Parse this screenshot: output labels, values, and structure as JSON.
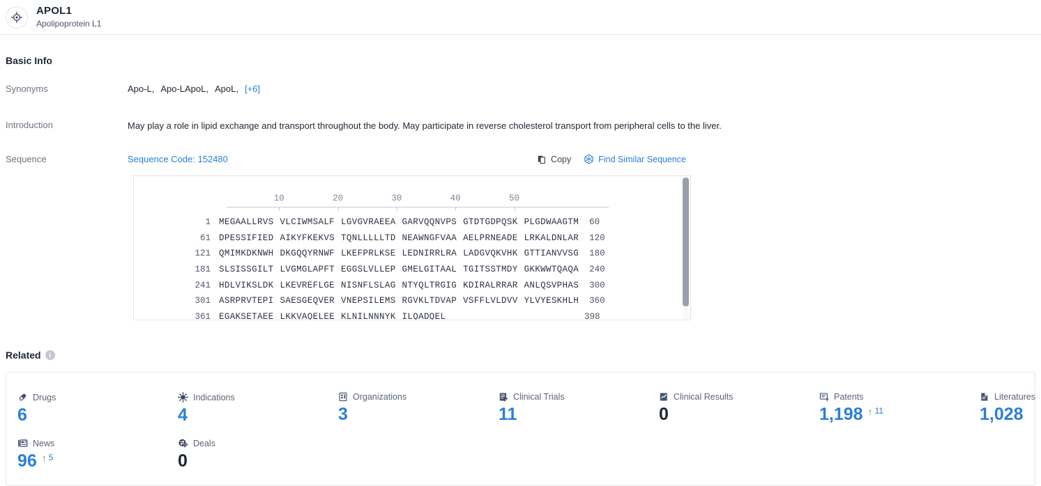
{
  "header": {
    "icon": "target-icon",
    "name": "APOL1",
    "subtitle": "Apolipoprotein L1"
  },
  "basic_info": {
    "title": "Basic Info",
    "synonyms": {
      "label": "Synonyms",
      "values": [
        "Apo-L,",
        "Apo-LApoL,",
        "ApoL,"
      ],
      "more": "[+6]"
    },
    "introduction": {
      "label": "Introduction",
      "text": "May play a role in lipid exchange and transport throughout the body. May participate in reverse cholesterol transport from peripheral cells to the liver."
    },
    "sequence": {
      "label": "Sequence",
      "code_label": "Sequence Code: 152480",
      "copy_label": "Copy",
      "similar_label": "Find Similar Sequence",
      "ruler": [
        10,
        20,
        30,
        40,
        50
      ],
      "lines": [
        {
          "start": "1",
          "blocks": [
            "MEGAALLRVS",
            "VLCIWMSALF",
            "LGVGVRAEEA",
            "GARVQQNVPS",
            "GTDTGDPQSK",
            "PLGDWAAGTM"
          ],
          "end": "60"
        },
        {
          "start": "61",
          "blocks": [
            "DPESSIFIED",
            "AIKYFKEKVS",
            "TQNLLLLLTD",
            "NEAWNGFVAA",
            "AELPRNEADE",
            "LRKALDNLAR"
          ],
          "end": "120"
        },
        {
          "start": "121",
          "blocks": [
            "QMIMKDKNWH",
            "DKGQQYRNWF",
            "LKEFPRLKSE",
            "LEDNIRRLRA",
            "LADGVQKVHK",
            "GTTIANVVSG"
          ],
          "end": "180"
        },
        {
          "start": "181",
          "blocks": [
            "SLSISSGILT",
            "LVGMGLAPFT",
            "EGGSLVLLEP",
            "GMELGITAAL",
            "TGITSSTMDY",
            "GKKWWTQAQA"
          ],
          "end": "240"
        },
        {
          "start": "241",
          "blocks": [
            "HDLVIKSLDK",
            "LKEVREFLGE",
            "NISNFLSLAG",
            "NTYQLTRGIG",
            "KDIRALRRAR",
            "ANLQSVPHAS"
          ],
          "end": "300"
        },
        {
          "start": "301",
          "blocks": [
            "ASRPRVTEPI",
            "SAESGEQVER",
            "VNEPSILEMS",
            "RGVKLTDVAP",
            "VSFFLVLDVV",
            "YLVYESKHLH"
          ],
          "end": "360"
        },
        {
          "start": "361",
          "blocks": [
            "EGAKSETAEE",
            "LKKVAQELEE",
            "KLNILNNNYK",
            "ILQADQEL"
          ],
          "end": "398"
        }
      ]
    }
  },
  "related": {
    "title": "Related",
    "info_glyph": "i",
    "stats": [
      {
        "icon": "pill-icon",
        "label": "Drugs",
        "value": "6",
        "is_zero": false,
        "delta": null
      },
      {
        "icon": "virus-icon",
        "label": "Indications",
        "value": "4",
        "is_zero": false,
        "delta": null
      },
      {
        "icon": "building-icon",
        "label": "Organizations",
        "value": "3",
        "is_zero": false,
        "delta": null
      },
      {
        "icon": "clinical-trial-icon",
        "label": "Clinical Trials",
        "value": "11",
        "is_zero": false,
        "delta": null
      },
      {
        "icon": "clinical-result-icon",
        "label": "Clinical Results",
        "value": "0",
        "is_zero": true,
        "delta": null
      },
      {
        "icon": "patent-icon",
        "label": "Patents",
        "value": "1,198",
        "is_zero": false,
        "delta": "11"
      },
      {
        "icon": "literature-icon",
        "label": "Literatures",
        "value": "1,028",
        "is_zero": false,
        "delta": null
      },
      {
        "icon": "news-icon",
        "label": "News",
        "value": "96",
        "is_zero": false,
        "delta": "5"
      },
      {
        "icon": "deals-icon",
        "label": "Deals",
        "value": "0",
        "is_zero": true,
        "delta": null
      }
    ],
    "delta_arrow": "↑"
  },
  "colors": {
    "link_blue": "#2b7fd4",
    "text_dark": "#1c2533",
    "label_gray": "#6b7482",
    "delta_green": "#37a93c"
  }
}
